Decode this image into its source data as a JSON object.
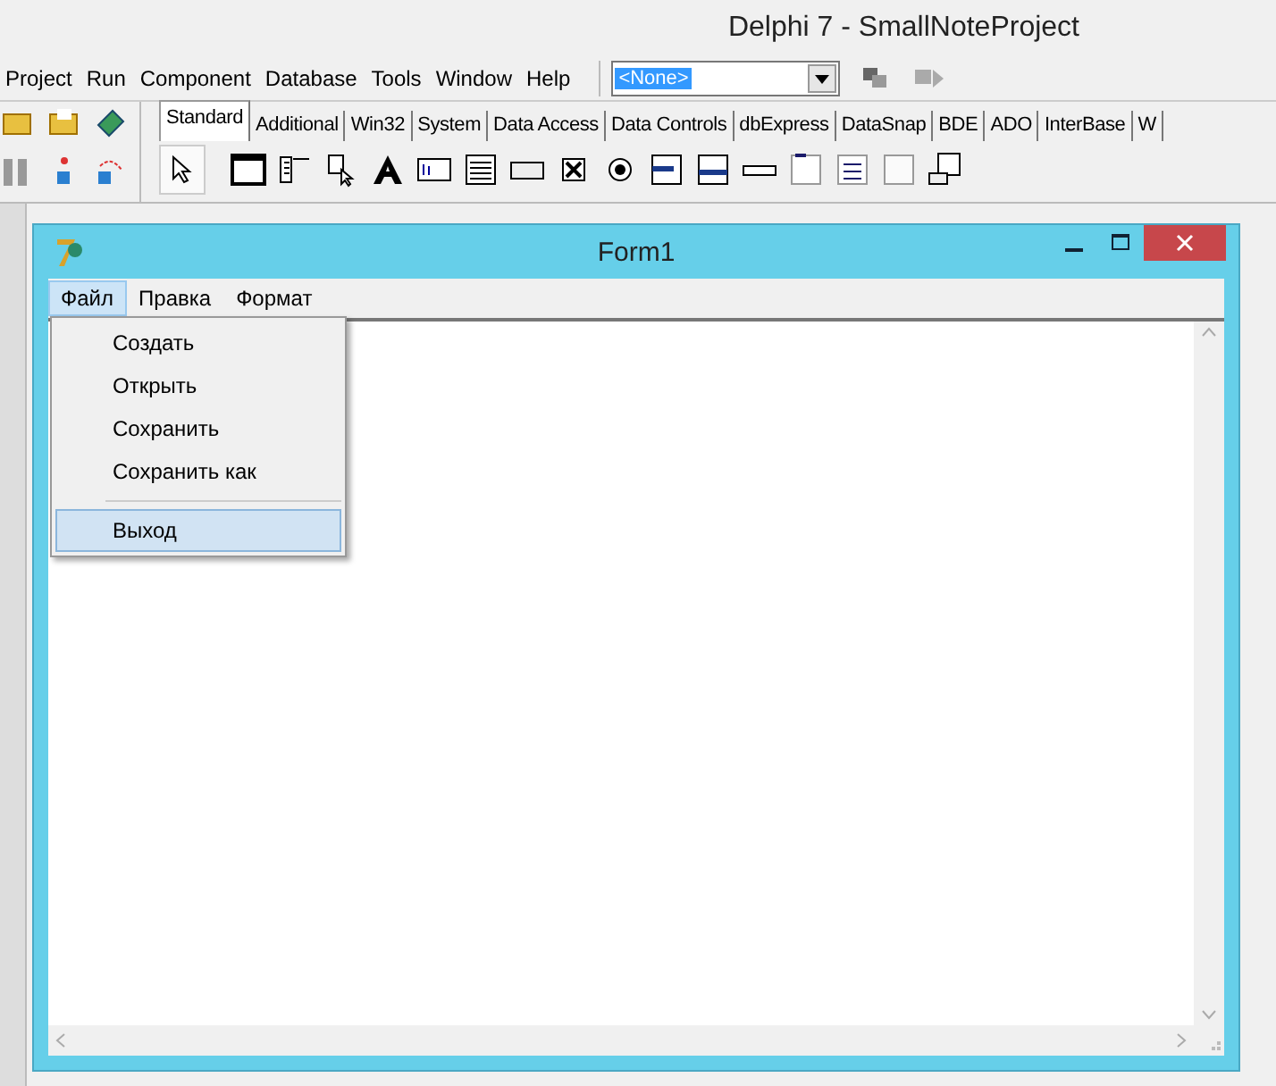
{
  "ide": {
    "title": "Delphi 7 - SmallNoteProject",
    "menu": [
      "Project",
      "Run",
      "Component",
      "Database",
      "Tools",
      "Window",
      "Help"
    ],
    "combo": {
      "value": "<None>"
    },
    "palette_tabs": [
      {
        "label": "Standard",
        "selected": true
      },
      {
        "label": "Additional",
        "selected": false
      },
      {
        "label": "Win32",
        "selected": false
      },
      {
        "label": "System",
        "selected": false
      },
      {
        "label": "Data Access",
        "selected": false
      },
      {
        "label": "Data Controls",
        "selected": false
      },
      {
        "label": "dbExpress",
        "selected": false
      },
      {
        "label": "DataSnap",
        "selected": false
      },
      {
        "label": "BDE",
        "selected": false
      },
      {
        "label": "ADO",
        "selected": false
      },
      {
        "label": "InterBase",
        "selected": false
      },
      {
        "label": "W",
        "selected": false
      }
    ]
  },
  "form": {
    "title": "Form1",
    "menu": [
      {
        "label": "Файл",
        "selected": true
      },
      {
        "label": "Правка",
        "selected": false
      },
      {
        "label": "Формат",
        "selected": false
      }
    ],
    "dropdown": [
      {
        "kind": "item",
        "label": "Создать",
        "selected": false
      },
      {
        "kind": "item",
        "label": "Открыть",
        "selected": false
      },
      {
        "kind": "item",
        "label": "Сохранить",
        "selected": false
      },
      {
        "kind": "item",
        "label": "Сохранить как",
        "selected": false
      },
      {
        "kind": "separator"
      },
      {
        "kind": "item",
        "label": "Выход",
        "selected": true
      }
    ]
  }
}
